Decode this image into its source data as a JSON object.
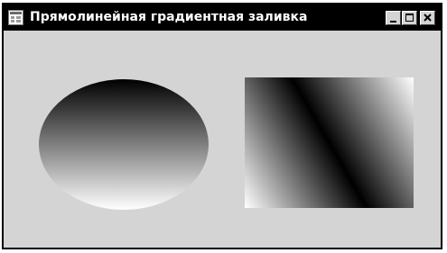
{
  "window": {
    "title": "Прямолинейная градиентная заливка",
    "icon": "app-form-icon",
    "buttons": {
      "minimize": "minimize-icon",
      "maximize": "maximize-icon",
      "close": "close-icon"
    }
  },
  "canvas": {
    "ellipse_gradient": {
      "direction": "vertical",
      "from": "#000000",
      "to": "#ffffff"
    },
    "rect_gradient": {
      "direction": "diagonal",
      "stops": [
        "#ffffff",
        "#000000",
        "#ffffff"
      ]
    }
  }
}
